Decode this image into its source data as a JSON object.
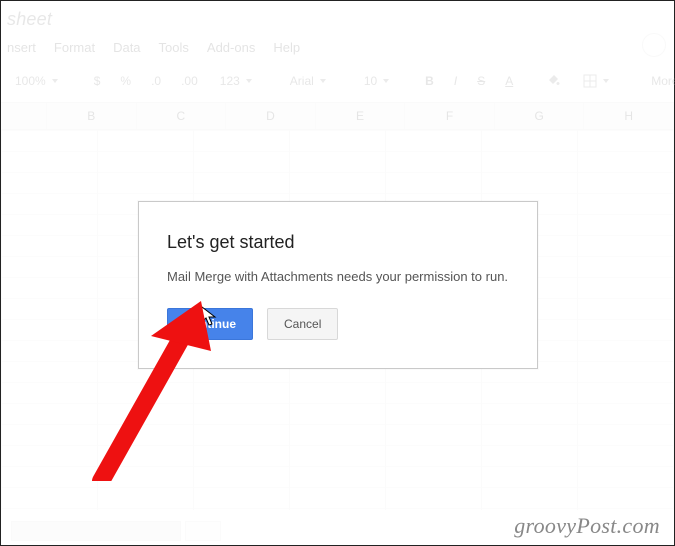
{
  "window": {
    "title_partial": "sheet"
  },
  "menubar": {
    "items": [
      "nsert",
      "Format",
      "Data",
      "Tools",
      "Add-ons",
      "Help"
    ]
  },
  "toolbar": {
    "zoom": "100%",
    "currency": "$",
    "percent": "%",
    "dec_dec": ".0",
    "inc_dec": ".00",
    "num_format": "123",
    "font": "Arial",
    "font_size": "10",
    "bold": "B",
    "italic": "I",
    "strike": "S",
    "text_color": "A",
    "more": "More"
  },
  "columns": [
    "",
    "B",
    "C",
    "D",
    "E",
    "F",
    "G",
    "H"
  ],
  "dialog": {
    "title": "Let's get started",
    "body": "Mail Merge with Attachments needs your permission to run.",
    "continue_label": "Continue",
    "cancel_label": "Cancel"
  },
  "watermark": "groovyPost.com"
}
